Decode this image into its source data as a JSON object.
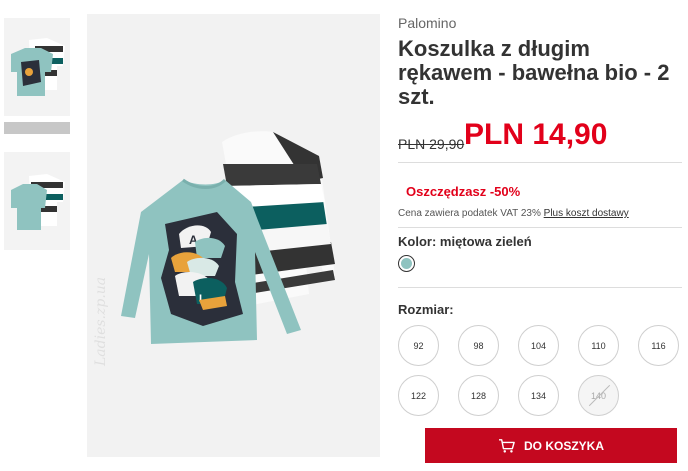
{
  "product": {
    "brand": "Palomino",
    "title": "Koszulka z długim rękawem - bawełna bio - 2 szt.",
    "price_old": "PLN 29,90",
    "price_new": "PLN 14,90",
    "saving": "Oszczędzasz -50%",
    "vat_text": "Cena zawiera podatek VAT 23%",
    "shipping_link": "Plus koszt dostawy",
    "color_label": "Kolor:",
    "color_value": "miętowa zieleń",
    "color_hex": "#8fc3c0",
    "size_label": "Rozmiar:",
    "sizes": [
      "92",
      "98",
      "104",
      "110",
      "116",
      "122",
      "128",
      "134",
      "140"
    ],
    "unavailable_sizes": [
      "140"
    ],
    "cart_button": "DO KOSZYKA"
  },
  "watermark": "Ladies.zp.ua",
  "colors": {
    "accent": "#e2001a",
    "button": "#c4081f",
    "mint": "#8fc3c0",
    "teal": "#0c5f5f"
  }
}
